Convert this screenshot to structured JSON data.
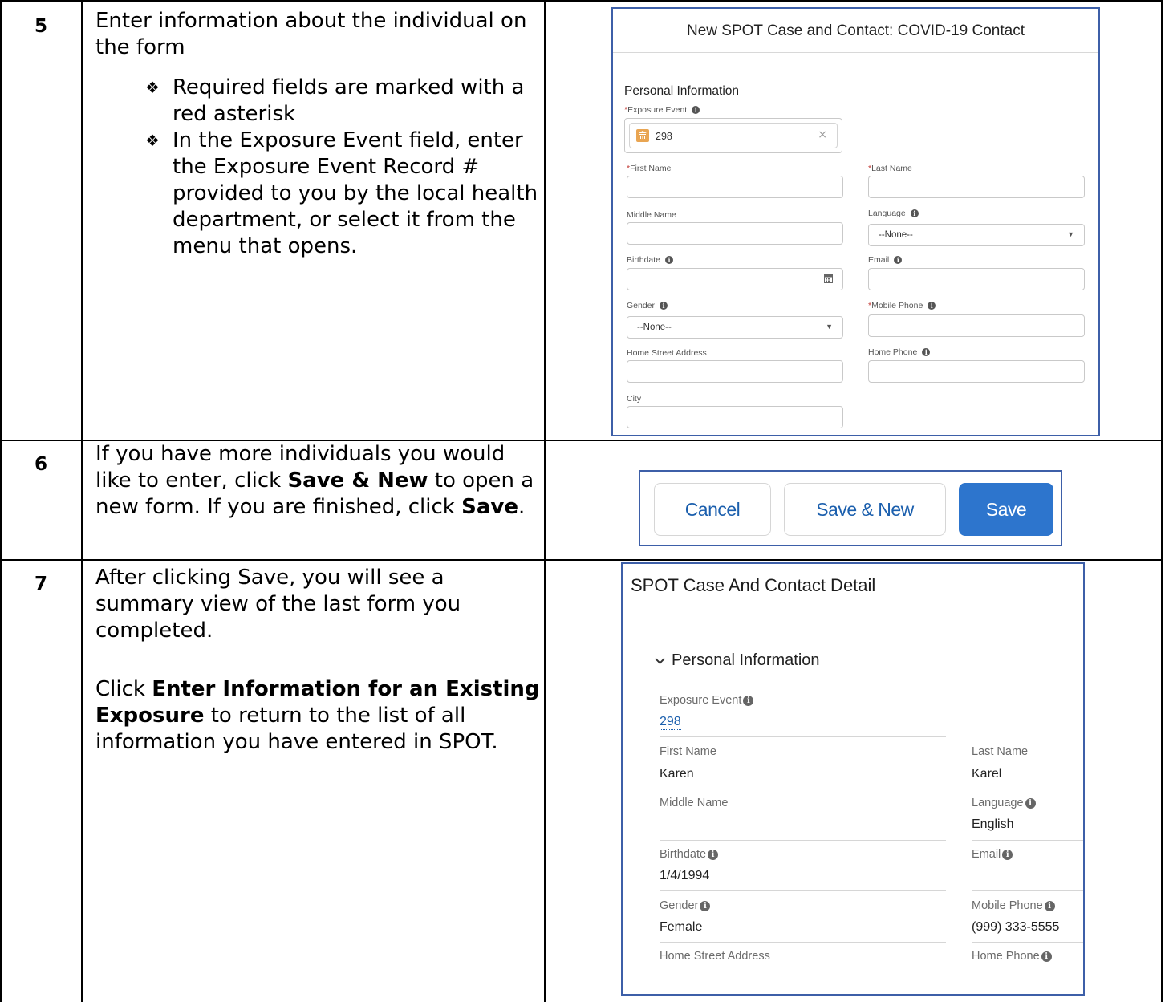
{
  "steps": [
    {
      "number": "5",
      "text": "Enter information about the individual on the form",
      "bullets": [
        "Required fields are marked with a red asterisk",
        "In the Exposure Event field, enter the Exposure Event Record # provided to you by the local health department, or select it from the menu that opens."
      ]
    },
    {
      "number": "6",
      "text_before": "If you have more individuals you would like to enter, click ",
      "bold1": "Save & New",
      "text_middle": " to open a new form. If you are finished, click ",
      "bold2": "Save",
      "text_after": "."
    },
    {
      "number": "7",
      "paragraph1": "After clicking Save, you will see a summary view of the last form you completed.",
      "p2_before": "Click ",
      "p2_bold": "Enter Information for an Existing Exposure",
      "p2_after": " to return to the list of all information you have entered in SPOT."
    }
  ],
  "form": {
    "title": "New SPOT Case and Contact: COVID-19 Contact",
    "section": "Personal Information",
    "required_marker": "*",
    "exposure_event_label": "Exposure Event",
    "exposure_event_value": "298",
    "clear_glyph": "×",
    "first_name_label": "First Name",
    "last_name_label": "Last Name",
    "middle_name_label": "Middle Name",
    "language_label": "Language",
    "language_value": "--None--",
    "birthdate_label": "Birthdate",
    "email_label": "Email",
    "gender_label": "Gender",
    "gender_value": "--None--",
    "mobile_phone_label": "Mobile Phone",
    "home_street_label": "Home Street Address",
    "home_phone_label": "Home Phone",
    "city_label": "City",
    "icons": {
      "info": "info-icon",
      "dropdown": "chevron-down-icon",
      "calendar": "calendar-icon",
      "lookup": "building-icon",
      "clear": "close-icon"
    },
    "colors": {
      "required": "#c23934",
      "lookup_icon": "#e9a552"
    }
  },
  "buttons": {
    "cancel": "Cancel",
    "save_new": "Save & New",
    "save": "Save",
    "colors": {
      "brand": "#2d75cd",
      "neutral_text": "#1b5fad"
    }
  },
  "detail": {
    "title": "SPOT Case And Contact Detail",
    "section": "Personal Information",
    "exposure_event_label": "Exposure Event",
    "exposure_event_value": "298",
    "first_name_label": "First Name",
    "first_name_value": "Karen",
    "last_name_label": "Last Name",
    "last_name_value": "Karel",
    "middle_name_label": "Middle Name",
    "language_label": "Language",
    "language_value": "English",
    "birthdate_label": "Birthdate",
    "birthdate_value": "1/4/1994",
    "email_label": "Email",
    "gender_label": "Gender",
    "gender_value": "Female",
    "mobile_phone_label": "Mobile Phone",
    "mobile_phone_value": "(999) 333-5555",
    "home_street_label": "Home Street Address",
    "home_phone_label": "Home Phone"
  }
}
